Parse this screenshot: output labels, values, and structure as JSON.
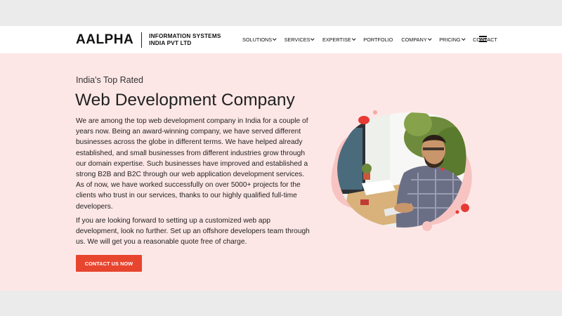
{
  "header": {
    "logo_main": "AALPHA",
    "logo_sub_line1": "INFORMATION SYSTEMS",
    "logo_sub_line2": "INDIA PVT LTD",
    "nav": [
      {
        "label": "SOLUTIONS",
        "dropdown": true
      },
      {
        "label": "SERVICES",
        "dropdown": true
      },
      {
        "label": "EXPERTISE",
        "dropdown": true
      },
      {
        "label": "PORTFOLIO",
        "dropdown": false
      },
      {
        "label": "COMPANY",
        "dropdown": true
      },
      {
        "label": "PRICING",
        "dropdown": true
      },
      {
        "label": "CONTACT",
        "dropdown": false
      }
    ],
    "menu_icon": "hamburger-icon"
  },
  "hero": {
    "eyebrow": "India's Top Rated",
    "title": "Web Development Company",
    "paragraph1": "We are among the top web development company in India for a couple of years now. Being an award-winning company, we have served different businesses across the globe in different terms. We have helped already established, and small businesses from different industries grow through our domain expertise. Such businesses have improved and established a strong B2B and B2C through our web application development services. As of now, we have worked successfully on over 5000+ projects for the clients who trust in our services, thanks to our highly qualified full-time developers.",
    "paragraph2": "If you are looking forward to setting up a customized web app development, look no further. Set up an offshore developers team through us. We will get you a reasonable quote free of charge.",
    "cta_label": "CONTACT US NOW"
  },
  "colors": {
    "hero_bg": "#fde7e6",
    "accent": "#e8452f",
    "blob": "#f7c4c2",
    "dot_red": "#e83a35"
  }
}
